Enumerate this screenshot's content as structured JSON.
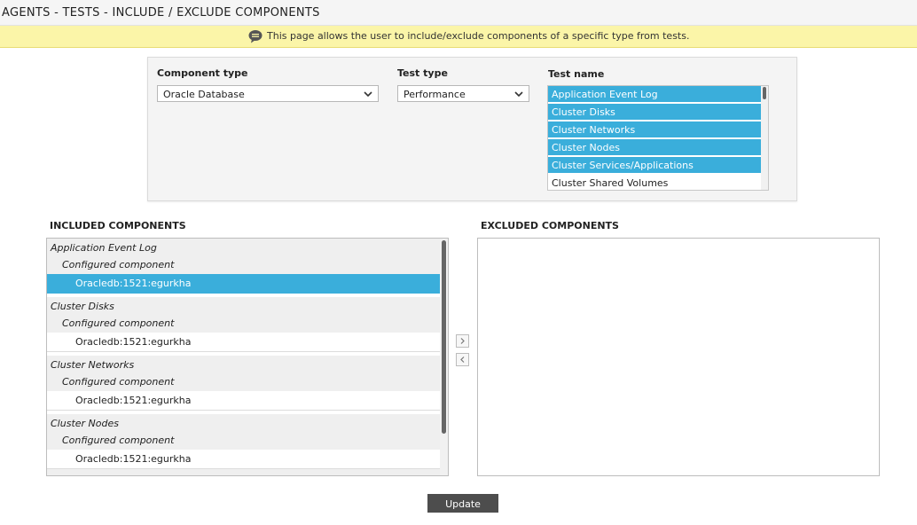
{
  "header": {
    "title": "AGENTS - TESTS - INCLUDE / EXCLUDE COMPONENTS"
  },
  "info": {
    "icon": "speech-bubble-icon",
    "text": "This page allows the user to include/exclude components of a specific type from tests."
  },
  "filters": {
    "component_type": {
      "label": "Component type",
      "value": "Oracle Database"
    },
    "test_type": {
      "label": "Test type",
      "value": "Performance"
    },
    "test_name": {
      "label": "Test name",
      "items": [
        {
          "label": "Application Event Log",
          "selected": true
        },
        {
          "label": "Cluster Disks",
          "selected": true
        },
        {
          "label": "Cluster Networks",
          "selected": true
        },
        {
          "label": "Cluster Nodes",
          "selected": true
        },
        {
          "label": "Cluster Services/Applications",
          "selected": true
        },
        {
          "label": "Cluster Shared Volumes",
          "selected": false
        }
      ]
    }
  },
  "included": {
    "heading": "INCLUDED COMPONENTS",
    "groups": [
      {
        "test": "Application Event Log",
        "config_label": "Configured component",
        "component": "Oracledb:1521:egurkha",
        "selected": true
      },
      {
        "test": "Cluster Disks",
        "config_label": "Configured component",
        "component": "Oracledb:1521:egurkha",
        "selected": false
      },
      {
        "test": "Cluster Networks",
        "config_label": "Configured component",
        "component": "Oracledb:1521:egurkha",
        "selected": false
      },
      {
        "test": "Cluster Nodes",
        "config_label": "Configured component",
        "component": "Oracledb:1521:egurkha",
        "selected": false
      }
    ]
  },
  "excluded": {
    "heading": "EXCLUDED COMPONENTS"
  },
  "actions": {
    "move_right_icon": "chevron-right-icon",
    "move_left_icon": "chevron-left-icon",
    "update_label": "Update"
  },
  "colors": {
    "selection": "#3aaedb",
    "info_bar": "#fbf5a8",
    "button": "#4d4d4d"
  }
}
